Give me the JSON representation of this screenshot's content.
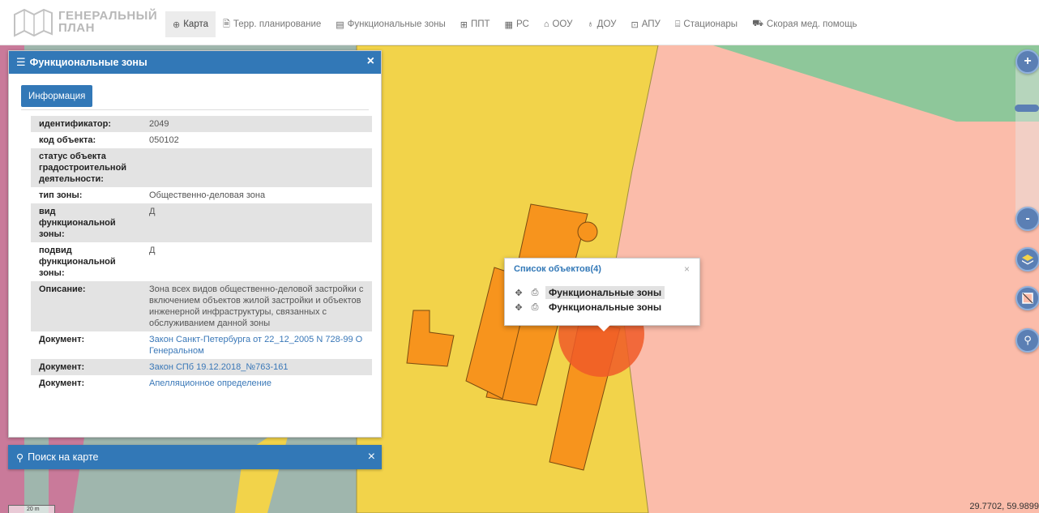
{
  "header": {
    "logo_line1": "ГЕНЕРАЛЬНЫЙ",
    "logo_line2": "ПЛАН",
    "nav": [
      {
        "label": "Карта",
        "icon": "globe-icon",
        "active": true
      },
      {
        "label": "Терр. планирование",
        "icon": "document-icon"
      },
      {
        "label": "Функциональные зоны",
        "icon": "list-icon"
      },
      {
        "label": "ППТ",
        "icon": "grid-icon"
      },
      {
        "label": "РС",
        "icon": "file-icon"
      },
      {
        "label": "ООУ",
        "icon": "school-icon"
      },
      {
        "label": "ДОУ",
        "icon": "kindergarten-icon"
      },
      {
        "label": "АПУ",
        "icon": "sign-icon"
      },
      {
        "label": "Стационары",
        "icon": "hospital-icon"
      },
      {
        "label": "Скорая мед. помощь",
        "icon": "ambulance-icon"
      }
    ]
  },
  "info_panel": {
    "title": "Функциональные зоны",
    "tab_label": "Информация",
    "rows": [
      {
        "key": "идентификатор:",
        "value": "2049"
      },
      {
        "key": "код объекта:",
        "value": "050102"
      },
      {
        "key": "статус объекта градостроительной деятельности:",
        "value": ""
      },
      {
        "key": "тип зоны:",
        "value": "Общественно-деловая зона"
      },
      {
        "key": "вид функциональной зоны:",
        "value": "Д"
      },
      {
        "key": "подвид функциональной зоны:",
        "value": "Д"
      },
      {
        "key": "Описание:",
        "value": "Зона всех видов общественно-деловой застройки с включением объектов жилой застройки и объектов инженерной инфраструктуры, связанных с обслуживанием данной зоны"
      },
      {
        "key": "Документ:",
        "value": "Закон Санкт-Петербурга от 22_12_2005 N 728-99 О Генеральном",
        "link": true
      },
      {
        "key": "Документ:",
        "value": "Закон СПб 19.12.2018_№763-161",
        "link": true
      },
      {
        "key": "Документ:",
        "value": "Апелляционное определение",
        "link": true
      }
    ]
  },
  "search_panel": {
    "title": "Поиск на карте"
  },
  "popup": {
    "title": "Список объектов(4)",
    "items": [
      "Функциональные зоны",
      "Функциональные зоны"
    ]
  },
  "map": {
    "coords": "29.7702, 59.9899",
    "scale_label": "20 m",
    "colors": {
      "public_zone": "#f2d34a",
      "residential_zone": "#fbbcaa",
      "green_zone": "#8ec79a",
      "building": "#f7941d",
      "highlight": "#f05a28",
      "grey_zone": "#a8b8b0"
    }
  },
  "controls": {
    "zoom_in": "+",
    "zoom_out": "-"
  }
}
